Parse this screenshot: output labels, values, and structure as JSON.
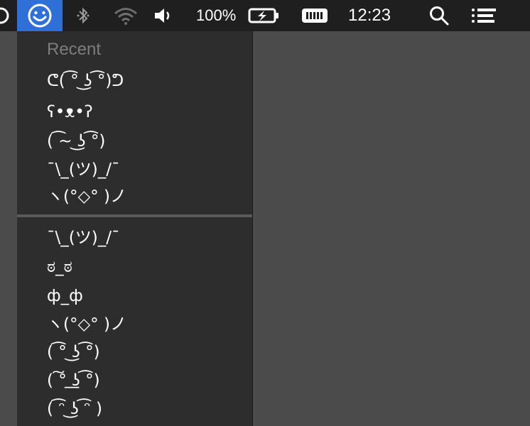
{
  "menubar": {
    "battery_text": "100%",
    "clock": "12:23",
    "icons": {
      "partial": "circle-icon",
      "smiley": "smiley-face-icon",
      "bluetooth": "bluetooth-icon",
      "wifi": "wifi-icon",
      "volume": "speaker-icon",
      "battery": "battery-charging-icon",
      "keyboard": "keyboard-icon",
      "search": "magnifier-icon",
      "list": "list-icon"
    },
    "accent": "#2f6fd8"
  },
  "menu": {
    "recent_heading": "Recent",
    "recent_items": [
      "ᕦ( ͡° ͜ʖ ͡°)ᕤ",
      "ʕ•ᴥ•ʔ",
      "( ͡~ ͜ʖ ͡°)",
      "¯\\_(ツ)_/¯",
      "ヽ(°◇° )ノ"
    ],
    "items": [
      "¯\\_(ツ)_/¯",
      "ಠ_ಠ",
      "ф_ф",
      "ヽ(°◇° )ノ",
      "( ͡° ͜ʖ ͡°)",
      "( ͠° ͟ʖ ͡°)",
      "( ͡ᵔ ͜ʖ ͡ᵔ )"
    ]
  }
}
